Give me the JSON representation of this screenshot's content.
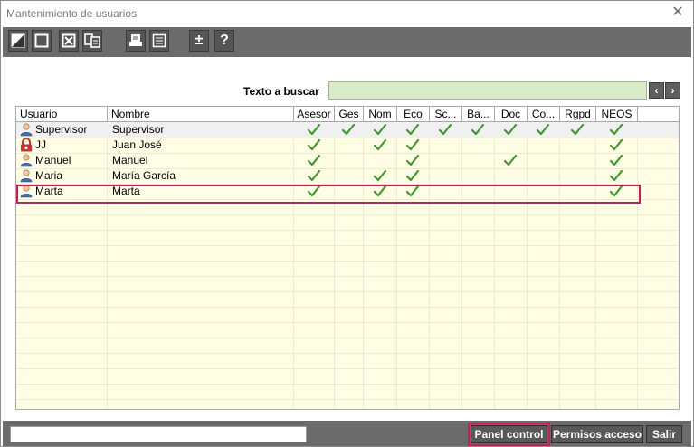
{
  "window": {
    "title": "Mantenimiento de usuarios",
    "close_glyph": "✕"
  },
  "toolbar": {
    "buttons": [
      {
        "icon": "edit-record-icon"
      },
      {
        "icon": "new-record-icon"
      },
      {
        "icon": "delete-record-icon"
      },
      {
        "icon": "copy-record-icon"
      },
      {
        "icon": "print-icon"
      },
      {
        "icon": "list-icon"
      },
      {
        "icon": "plus-minus-icon",
        "glyph": "±"
      },
      {
        "icon": "help-icon",
        "glyph": "?"
      }
    ]
  },
  "search": {
    "label": "Texto a buscar",
    "value": "",
    "prev": "‹",
    "next": "›"
  },
  "grid": {
    "columns": [
      "Usuario",
      "Nombre",
      "Asesor",
      "Ges",
      "Nom",
      "Eco",
      "Sc...",
      "Ba...",
      "Doc",
      "Co...",
      "Rgpd",
      "NEOS"
    ],
    "rows": [
      {
        "usuario": "Supervisor",
        "nombre": "Supervisor",
        "icon": "user-icon",
        "checks": [
          true,
          true,
          true,
          true,
          true,
          true,
          true,
          true,
          true,
          true
        ]
      },
      {
        "usuario": "JJ",
        "nombre": "Juan José",
        "icon": "locked-user-icon",
        "checks": [
          true,
          false,
          true,
          true,
          false,
          false,
          false,
          false,
          false,
          true
        ]
      },
      {
        "usuario": "Manuel",
        "nombre": "Manuel",
        "icon": "user-icon",
        "checks": [
          true,
          false,
          false,
          true,
          false,
          false,
          true,
          false,
          false,
          true
        ]
      },
      {
        "usuario": "Maria",
        "nombre": "María García",
        "icon": "user-icon",
        "checks": [
          true,
          false,
          true,
          true,
          false,
          false,
          false,
          false,
          false,
          true
        ]
      },
      {
        "usuario": "Marta",
        "nombre": "Marta",
        "icon": "user-icon",
        "checks": [
          true,
          false,
          true,
          true,
          false,
          false,
          false,
          false,
          false,
          true
        ]
      }
    ]
  },
  "footer": {
    "status_text": "",
    "panel_control": "Panel control",
    "permisos_acceso": "Permisos acceso",
    "salir": "Salir"
  },
  "colors": {
    "toolbar": "#6b6b6b",
    "grid_background": "#fffde3",
    "search_field": "#d9ecc9",
    "highlight": "#d6185b",
    "check": "#3a9a2a"
  }
}
